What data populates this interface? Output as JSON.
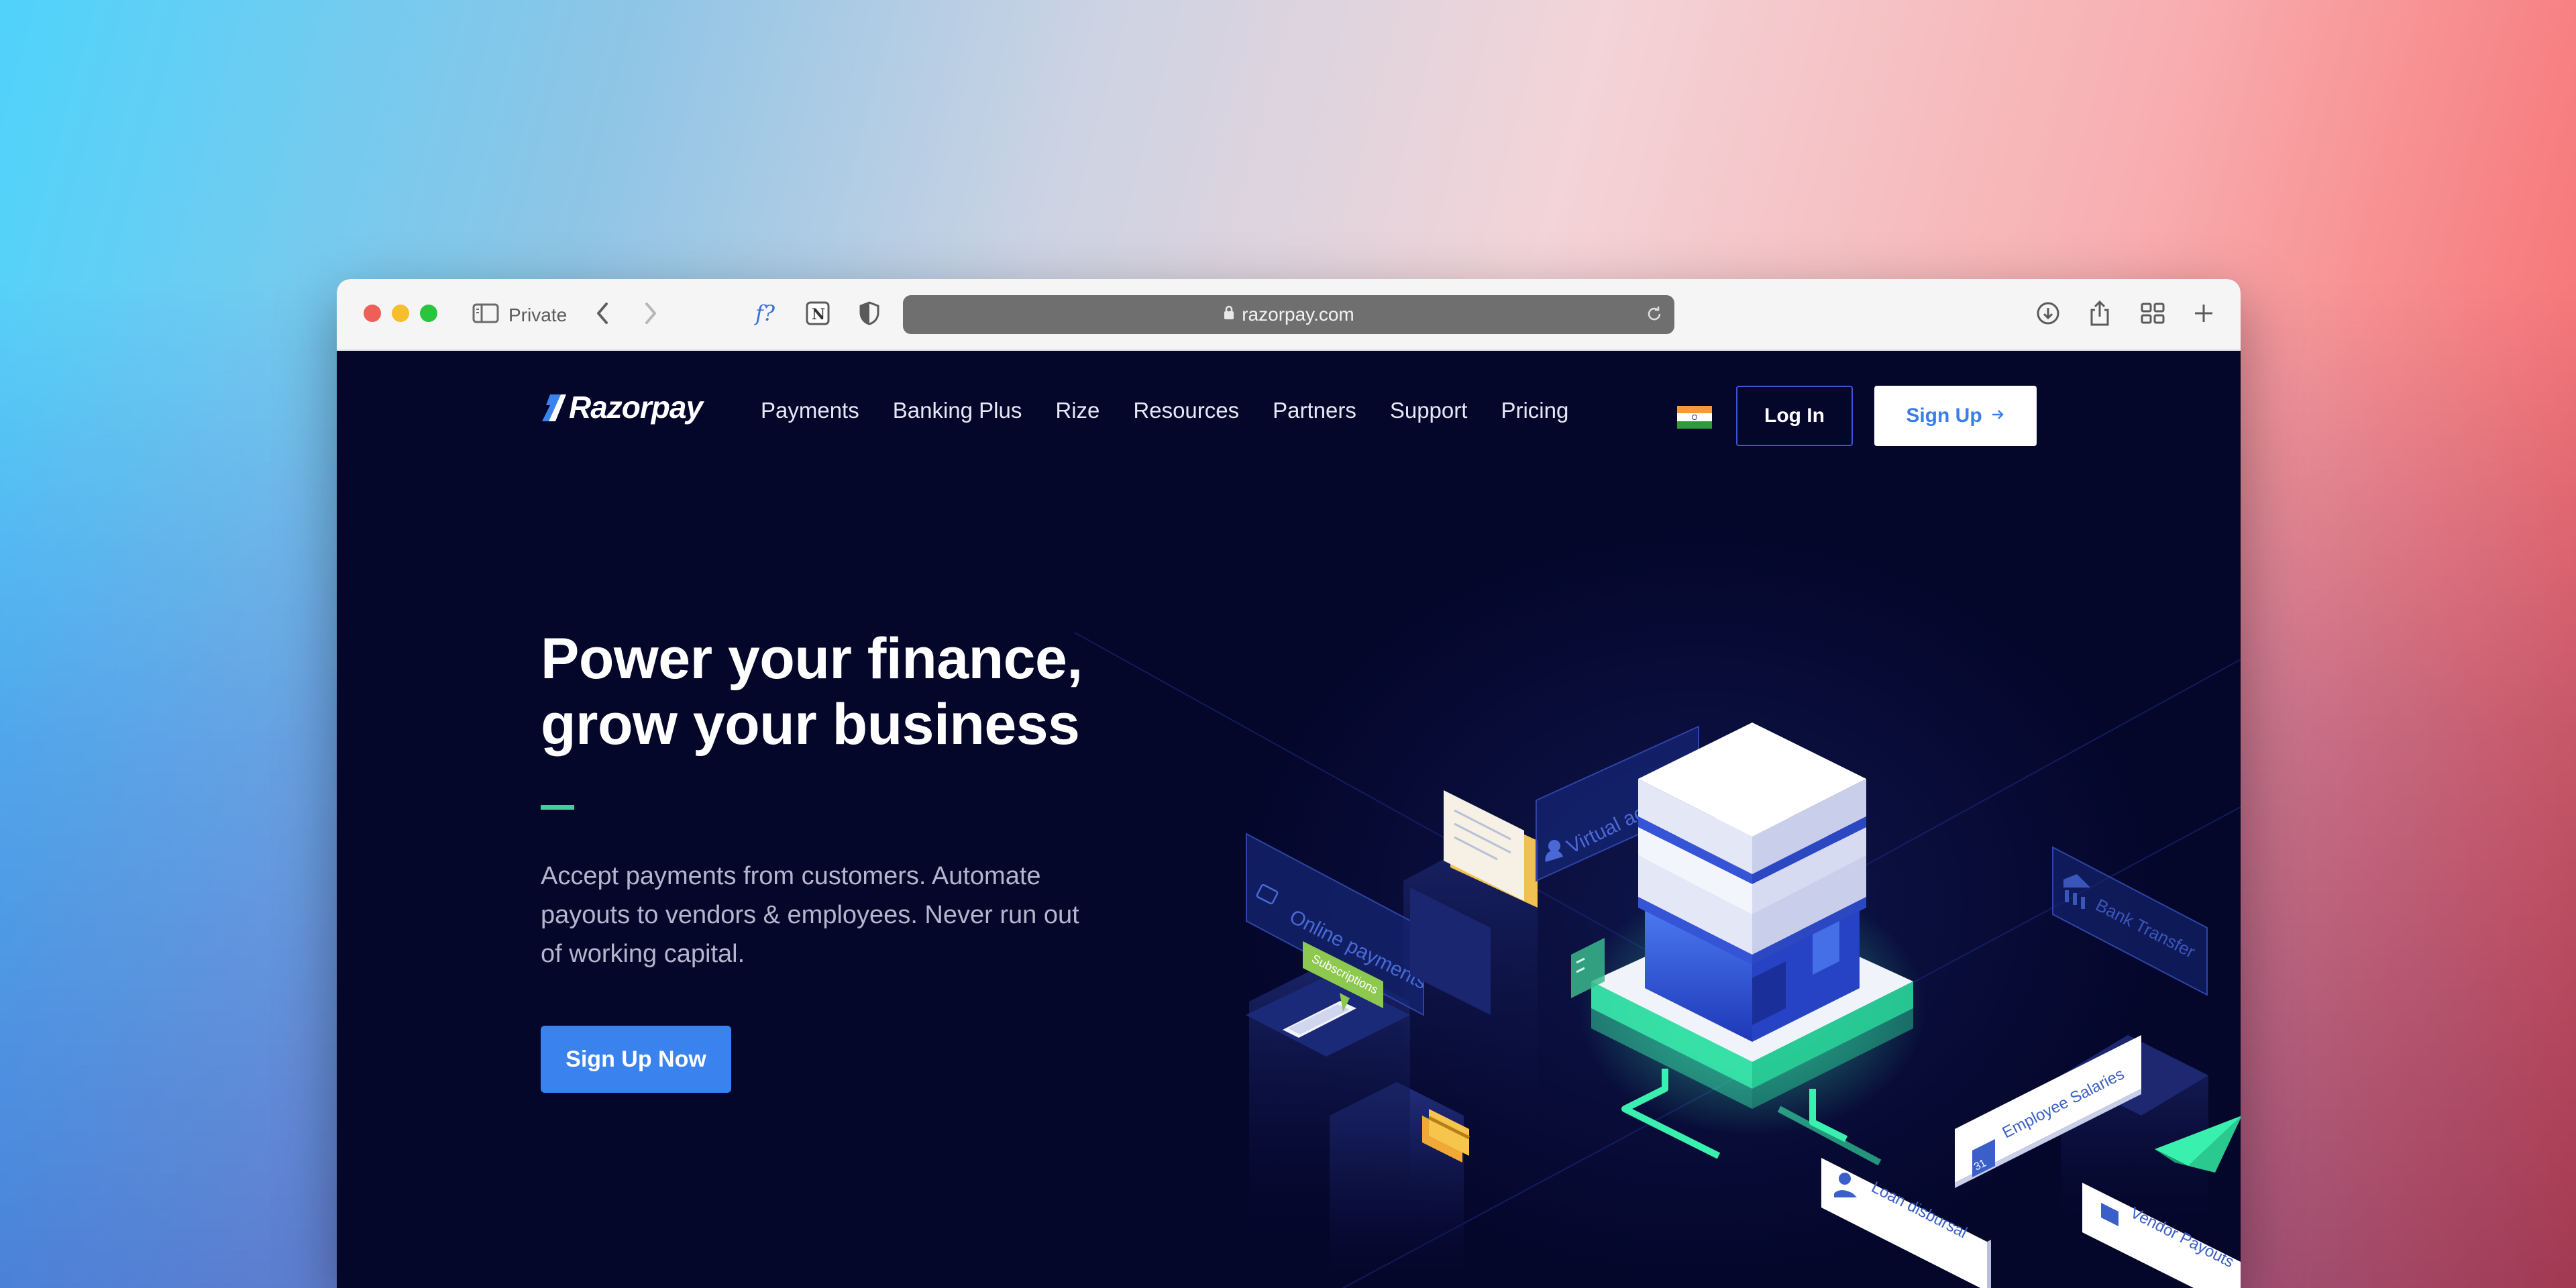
{
  "browser": {
    "private_label": "Private",
    "url": "razorpay.com"
  },
  "nav": {
    "logo_text": "Razorpay",
    "items": [
      {
        "label": "Payments"
      },
      {
        "label": "Banking Plus"
      },
      {
        "label": "Rize"
      },
      {
        "label": "Resources"
      },
      {
        "label": "Partners"
      },
      {
        "label": "Support"
      },
      {
        "label": "Pricing"
      }
    ],
    "login_label": "Log In",
    "signup_label": "Sign Up"
  },
  "hero": {
    "title_line1": "Power your finance,",
    "title_line2": "grow your business",
    "subtitle": "Accept payments from customers. Automate payouts to vendors & employees. Never run out of working capital.",
    "cta_label": "Sign Up Now"
  },
  "illustration": {
    "labels": {
      "virtual_accounts": "Virtual accounts",
      "online_payments": "Online payments",
      "bank_transfer": "Bank Transfer",
      "subscriptions": "Subscriptions",
      "employee_salaries": "Employee Salaries",
      "loan_disbursal": "Loan disbursal",
      "vendor_payouts": "Vendor Payouts",
      "calendar_day": "31"
    }
  },
  "colors": {
    "page_bg": "#04062a",
    "brand_blue": "#3a82ee",
    "accent_green": "#3dd1a0"
  }
}
